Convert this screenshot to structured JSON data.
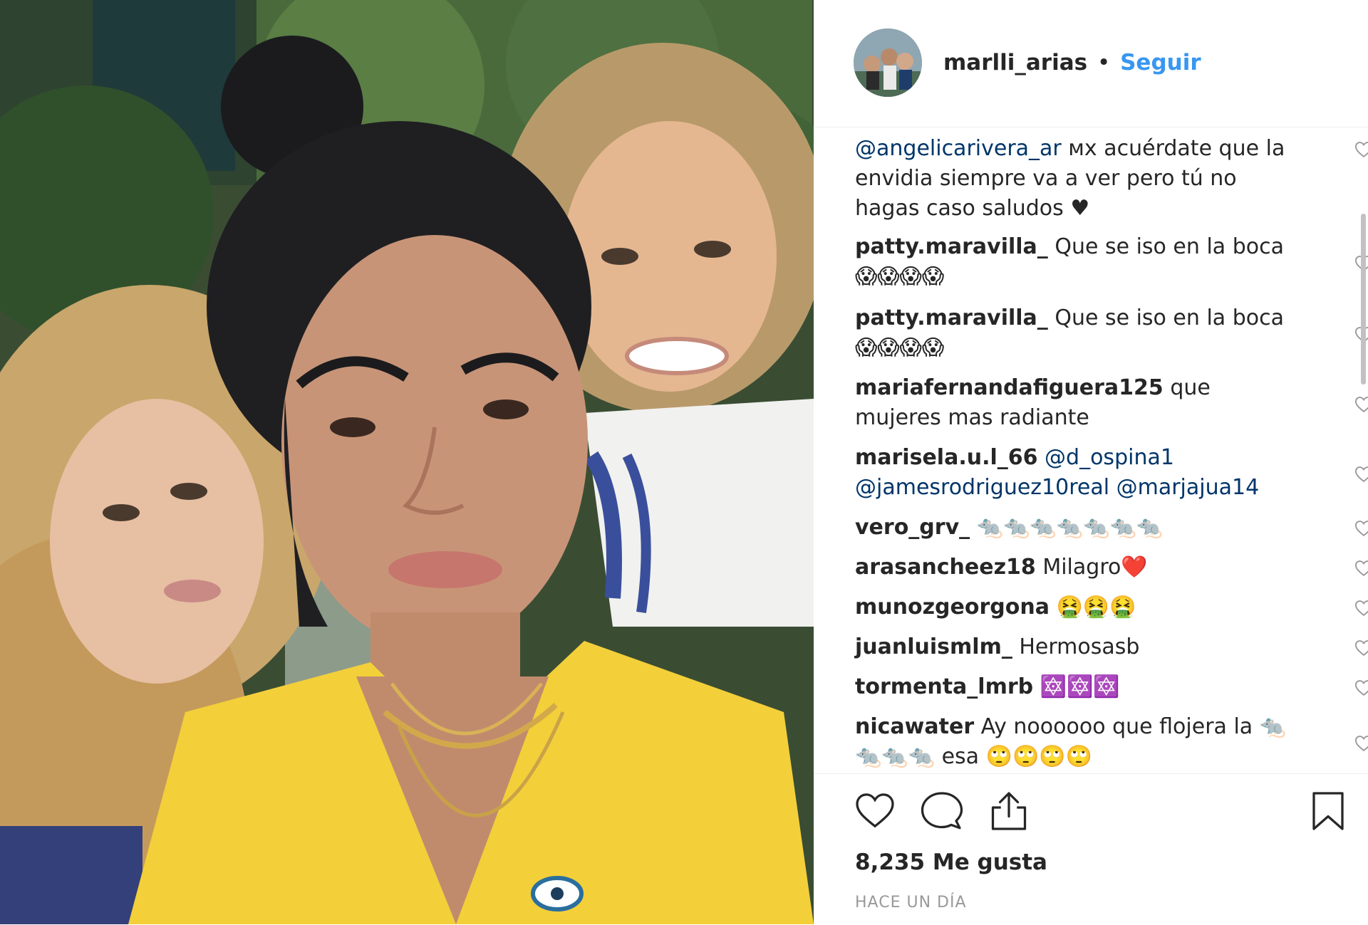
{
  "post": {
    "username": "marlli_arias",
    "separator": "•",
    "follow_label": "Seguir",
    "likes": "8,235 Me gusta",
    "time_ago": "HACE UN DÍA"
  },
  "comments": [
    {
      "user": "",
      "mention": "@angelicarivera_ar",
      "text": " ᴍx acuérdate que la envidia siempre va a ver pero tú no hagas caso saludos ♥"
    },
    {
      "user": "patty.maravilla_",
      "mention": "",
      "text": " Que se iso en la boca 😱😱😱😱"
    },
    {
      "user": "patty.maravilla_",
      "mention": "",
      "text": " Que se iso en la boca 😱😱😱😱"
    },
    {
      "user": "mariafernandafiguera125",
      "mention": "",
      "text": " que mujeres mas radiante"
    },
    {
      "user": "marisela.u.l_66",
      "mention": " @d_ospina1 @jamesrodriguez10real @marjajua14",
      "text": ""
    },
    {
      "user": "vero_grv_",
      "mention": "",
      "text": " 🐀🐀🐀🐀🐀🐀🐀"
    },
    {
      "user": "arasancheez18",
      "mention": "",
      "text": " Milagro❤️"
    },
    {
      "user": "munozgeorgona",
      "mention": "",
      "text": " 🤮🤮🤮"
    },
    {
      "user": "juanluismlm_",
      "mention": "",
      "text": "  Hermosasb"
    },
    {
      "user": "tormenta_lmrb",
      "mention": "",
      "text": " 🔯🔯🔯"
    },
    {
      "user": "nicawater",
      "mention": "",
      "text": " Ay noooooo que flojera la 🐀🐀🐀🐀 esa 🙄🙄🙄🙄"
    }
  ],
  "icons": {
    "like": "heart-icon",
    "comment": "comment-icon",
    "share": "share-icon",
    "save": "bookmark-icon",
    "comment_like": "heart-outline-icon"
  },
  "colors": {
    "link": "#3897f0",
    "mention": "#003569",
    "text": "#262626",
    "muted": "#999999"
  }
}
